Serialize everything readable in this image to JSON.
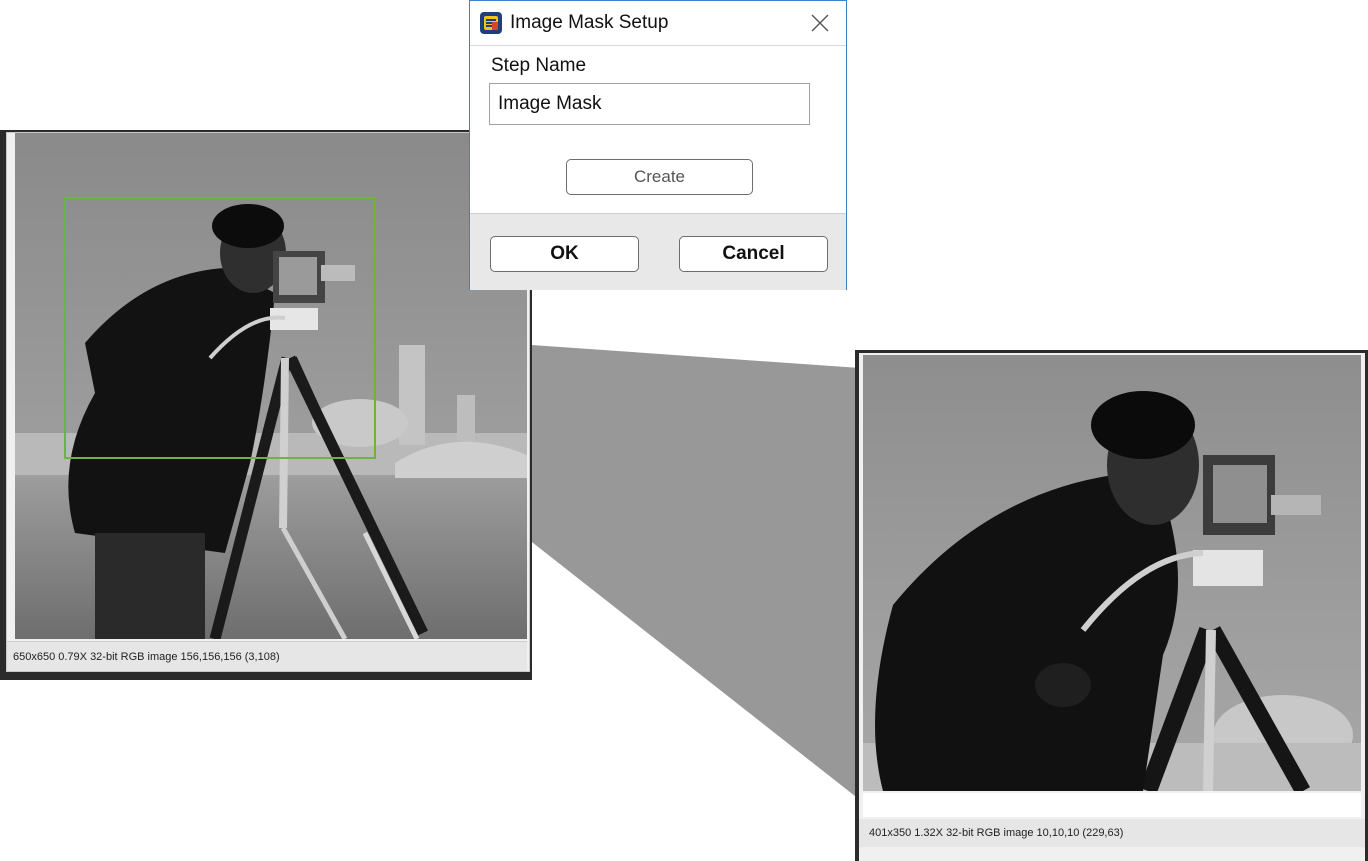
{
  "dialog": {
    "title": "Image Mask Setup",
    "step_name_label": "Step Name",
    "step_name_value": "Image Mask",
    "create_label": "Create",
    "ok_label": "OK",
    "cancel_label": "Cancel"
  },
  "left_window": {
    "status": "650x650 0.79X 32-bit RGB image 156,156,156     (3,108)"
  },
  "right_window": {
    "status": "401x350 1.32X 32-bit RGB image 10,10,10     (229,63)"
  },
  "colors": {
    "roi": "#6db33f",
    "dialog_border": "#3c82c8",
    "funnel": "#8c8c8c"
  }
}
